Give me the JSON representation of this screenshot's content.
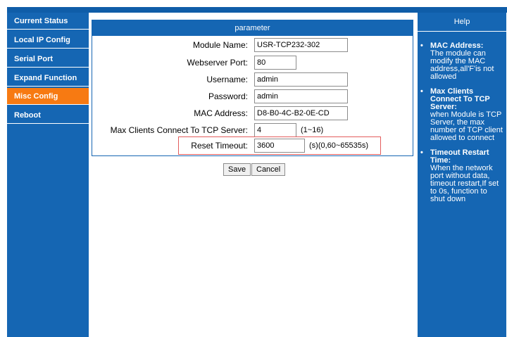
{
  "sidebar": {
    "items": [
      {
        "label": "Current Status",
        "active": false
      },
      {
        "label": "Local IP Config",
        "active": false
      },
      {
        "label": "Serial Port",
        "active": false
      },
      {
        "label": "Expand Function",
        "active": false
      },
      {
        "label": "Misc Config",
        "active": true
      },
      {
        "label": "Reboot",
        "active": false
      }
    ]
  },
  "panel": {
    "title": "parameter",
    "fields": {
      "module_name": {
        "label": "Module Name:",
        "value": "USR-TCP232-302"
      },
      "webserver_port": {
        "label": "Webserver Port:",
        "value": "80"
      },
      "username": {
        "label": "Username:",
        "value": "admin"
      },
      "password": {
        "label": "Password:",
        "value": "admin"
      },
      "mac_address": {
        "label": "MAC Address:",
        "value": "D8-B0-4C-B2-0E-CD"
      },
      "max_clients": {
        "label": "Max Clients Connect To TCP Server:",
        "value": "4",
        "hint": "(1~16)"
      },
      "reset_timeout": {
        "label": "Reset Timeout:",
        "value": "3600",
        "hint": "(s)(0,60~65535s)"
      }
    }
  },
  "actions": {
    "save_label": "Save",
    "cancel_label": "Cancel"
  },
  "help": {
    "title": "Help",
    "bullet": "•",
    "items": [
      {
        "head": "MAC Address:",
        "desc": "The module can modify the MAC address,all'F'is not allowed"
      },
      {
        "head": "Max Clients Connect To TCP Server:",
        "desc": "when Module is TCP Server, the max number of TCP client allowed to connect"
      },
      {
        "head": "Timeout Restart Time:",
        "desc": "When the network port without data, timeout restart,If set to 0s, function to shut down"
      }
    ]
  },
  "colors": {
    "primary_blue": "#1566b3",
    "active_orange": "#f77a12",
    "highlight_red": "#e35c5c"
  }
}
